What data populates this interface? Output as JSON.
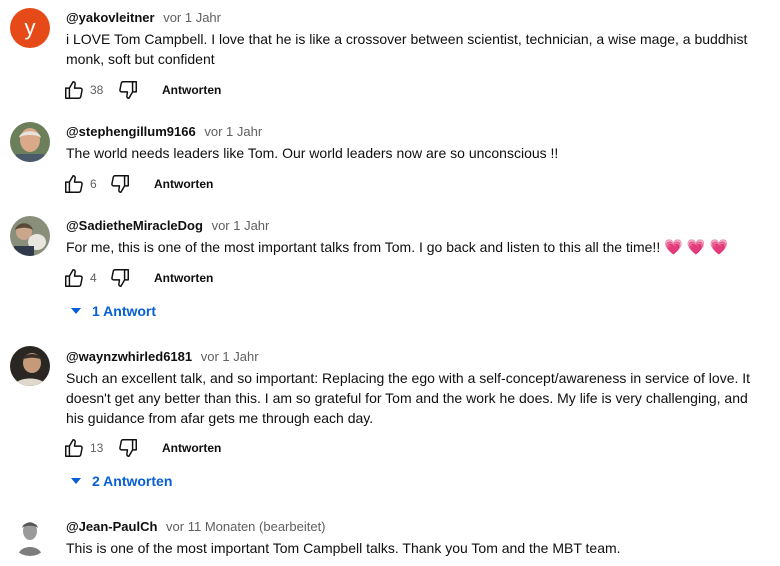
{
  "comments": [
    {
      "author": "@yakovleitner",
      "time": "vor 1 Jahr",
      "avatar_letter": "y",
      "text": "i LOVE Tom Campbell. I love that he is like a crossover between scientist, technician, a wise mage, a buddhist monk, soft but confident",
      "likes": "38",
      "reply_label": "Antworten"
    },
    {
      "author": "@stephengillum9166",
      "time": "vor 1 Jahr",
      "text": "The world needs leaders like Tom. Our world leaders now are so unconscious !!",
      "likes": "6",
      "reply_label": "Antworten"
    },
    {
      "author": "@SadietheMiracleDog",
      "time": "vor 1 Jahr",
      "text": "For me, this is one of the most important talks from Tom. I go back and listen to this all the time!!",
      "emoji": "💗💗💗",
      "likes": "4",
      "reply_label": "Antworten",
      "replies_label": "1 Antwort"
    },
    {
      "author": "@waynzwhirled6181",
      "time": "vor 1 Jahr",
      "text": "Such an excellent talk, and so important:  Replacing the ego with a self-concept/awareness in service of love.  It doesn't get any better than this.  I am so grateful for Tom and the work he does.  My life is very challenging, and his guidance from afar gets me through each day.",
      "likes": "13",
      "reply_label": "Antworten",
      "replies_label": "2 Antworten"
    },
    {
      "author": "@Jean-PaulCh",
      "time": "vor 11 Monaten (bearbeitet)",
      "text": "This is one of the most important Tom Campbell talks. Thank you Tom and the MBT team."
    }
  ],
  "colors": {
    "link_blue": "#065fd4",
    "avatar_orange": "#e64a19",
    "meta_gray": "#606060"
  },
  "icons": [
    "thumb-up-icon",
    "thumb-down-icon",
    "chevron-down-icon"
  ]
}
